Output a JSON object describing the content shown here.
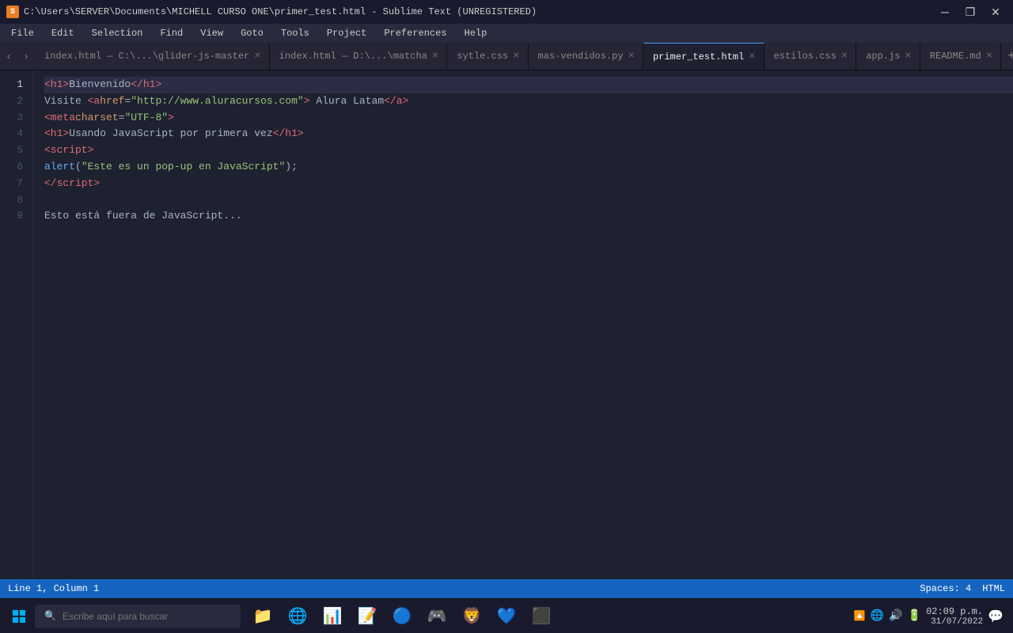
{
  "titlebar": {
    "icon_label": "S",
    "title": "C:\\Users\\SERVER\\Documents\\MICHELL CURSO ONE\\primer_test.html - Sublime Text (UNREGISTERED)",
    "minimize": "─",
    "maximize": "❐",
    "close": "✕"
  },
  "menubar": {
    "items": [
      "File",
      "Edit",
      "Selection",
      "Find",
      "View",
      "Goto",
      "Tools",
      "Project",
      "Preferences",
      "Help"
    ]
  },
  "tabs": [
    {
      "id": "tab1",
      "label": "index.html — C:\\...\\glider-js-master",
      "active": false
    },
    {
      "id": "tab2",
      "label": "index.html — D:\\...\\matcha",
      "active": false
    },
    {
      "id": "tab3",
      "label": "sytle.css",
      "active": false
    },
    {
      "id": "tab4",
      "label": "mas-vendidos.py",
      "active": false
    },
    {
      "id": "tab5",
      "label": "primer_test.html",
      "active": true
    },
    {
      "id": "tab6",
      "label": "estilos.css",
      "active": false
    },
    {
      "id": "tab7",
      "label": "app.js",
      "active": false
    },
    {
      "id": "tab8",
      "label": "README.md",
      "active": false
    }
  ],
  "code_lines": [
    {
      "num": 1,
      "active": true,
      "html": "<span class='tag'>&lt;h1&gt;</span><span class='text-content'>Bienvenido</span><span class='tag'>&lt;/h1&gt;</span>"
    },
    {
      "num": 2,
      "active": false,
      "html": "<span class='text-content'>Visite </span><span class='tag'>&lt;a</span> <span class='attr-name'>href</span><span class='plain'>=</span><span class='attr-value'>\"http://www.aluracursos.com\"</span><span class='tag'>&gt;</span><span class='text-content'> Alura Latam</span><span class='tag'>&lt;/a&gt;</span>"
    },
    {
      "num": 3,
      "active": false,
      "html": "    <span class='tag'>&lt;meta</span> <span class='attr-name'>charset</span><span class='plain'>=</span><span class='attr-value'>\"UTF-8\"</span><span class='tag'>&gt;</span>"
    },
    {
      "num": 4,
      "active": false,
      "html": "    <span class='tag'>&lt;h1&gt;</span><span class='text-content'>Usando JavaScript por primera vez</span><span class='tag'>&lt;/h1&gt;</span>"
    },
    {
      "num": 5,
      "active": false,
      "html": "    <span class='tag'>&lt;script&gt;</span>"
    },
    {
      "num": 6,
      "active": false,
      "html": "        <span class='fn-call'>alert</span><span class='plain'>(</span><span class='string'>\"Este es un pop-up en JavaScript\"</span><span class='plain'>);</span>"
    },
    {
      "num": 7,
      "active": false,
      "html": "    <span class='tag'>&lt;/script&gt;</span>"
    },
    {
      "num": 8,
      "active": false,
      "html": ""
    },
    {
      "num": 9,
      "active": false,
      "html": "<span class='text-content'>Esto está fuera de JavaScript...</span>"
    }
  ],
  "statusbar": {
    "position": "Line 1, Column 1",
    "spaces": "Spaces: 4",
    "encoding": "HTML"
  },
  "taskbar": {
    "search_placeholder": "Escribe aquí para buscar",
    "apps": [
      {
        "name": "windows-explorer",
        "icon": "📁",
        "color": "#f9a825"
      },
      {
        "name": "edge-browser",
        "icon": "🌐",
        "color": "#0078d4"
      },
      {
        "name": "excel",
        "icon": "📊",
        "color": "#217346"
      },
      {
        "name": "word",
        "icon": "📝",
        "color": "#2b579a"
      },
      {
        "name": "chrome",
        "icon": "🔵",
        "color": "#4285f4"
      },
      {
        "name": "cs-app",
        "icon": "🎮",
        "color": "#555"
      },
      {
        "name": "brave",
        "icon": "🦁",
        "color": "#fb542b"
      },
      {
        "name": "vs-code",
        "icon": "💙",
        "color": "#007acc"
      },
      {
        "name": "sublime",
        "icon": "⬛",
        "color": "#ff6a00"
      }
    ],
    "sys_icons": [
      "🔼",
      "💻",
      "🔊",
      "📡"
    ],
    "clock": {
      "time": "02:09 p.m.",
      "date": "31/07/2022"
    },
    "notification": "💬"
  }
}
